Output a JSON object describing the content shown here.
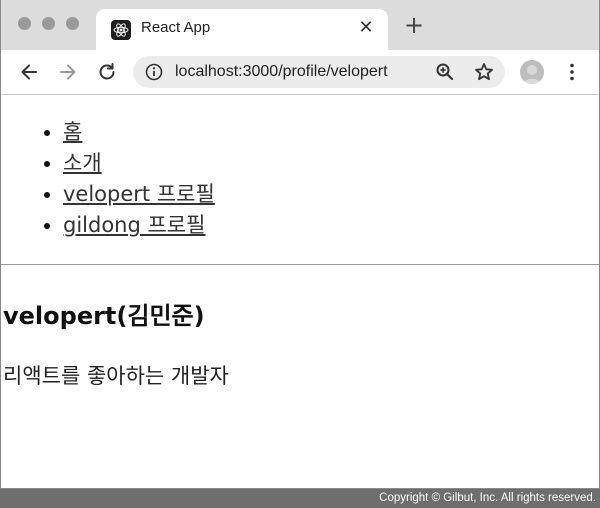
{
  "browser": {
    "tab": {
      "title": "React App",
      "favicon": "react-logo-icon",
      "close_symbol": "✕"
    },
    "new_tab_symbol": "+",
    "toolbar": {
      "back_icon": "back-arrow-icon",
      "forward_icon": "forward-arrow-icon",
      "reload_icon": "reload-icon",
      "url": "localhost:3000/profile/velopert",
      "info_icon": "info-icon",
      "zoom_icon": "zoom-icon",
      "bookmark_icon": "star-icon",
      "profile_icon": "avatar",
      "menu_icon": "more-vertical-icon"
    }
  },
  "page": {
    "nav": [
      {
        "label": "홈"
      },
      {
        "label": "소개"
      },
      {
        "label": "velopert 프로필"
      },
      {
        "label": "gildong 프로필"
      }
    ],
    "profile": {
      "name": "velopert(김민준)",
      "description": "리액트를 좋아하는 개발자"
    }
  },
  "footer": {
    "copyright": "Copyright © Gilbut, Inc. All rights reserved."
  }
}
